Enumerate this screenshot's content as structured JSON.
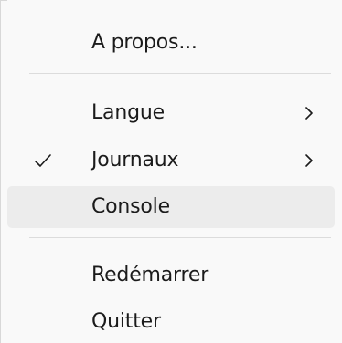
{
  "menu": {
    "items": [
      {
        "label": "A propos..."
      },
      {
        "label": "Langue",
        "has_submenu": true
      },
      {
        "label": "Journaux",
        "has_submenu": true,
        "checked": true
      },
      {
        "label": "Console",
        "highlighted": true
      },
      {
        "label": "Redémarrer"
      },
      {
        "label": "Quitter"
      }
    ]
  },
  "icons": {
    "check": "checkmark-icon",
    "submenu": "chevron-right-icon"
  },
  "colors": {
    "menu_background": "#f9f9f9",
    "highlight": "#ececec",
    "separator": "#dcdcdc",
    "text": "#1b1b1b"
  }
}
